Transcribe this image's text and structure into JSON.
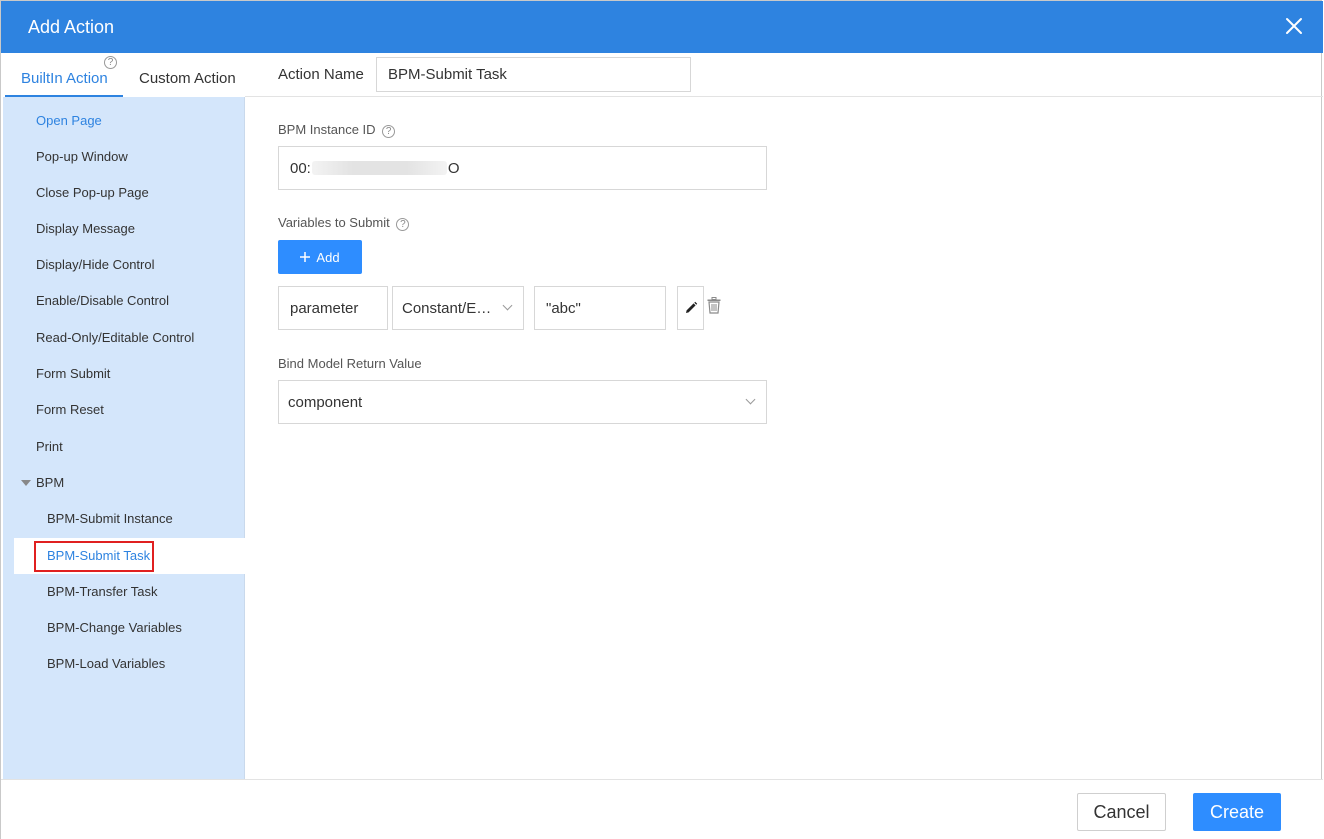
{
  "dialog": {
    "title": "Add Action",
    "close_icon": "close-icon"
  },
  "tabs": [
    {
      "label": "BuiltIn Action",
      "active": true
    },
    {
      "label": "Custom Action",
      "active": false
    }
  ],
  "tab_help": "?",
  "nav": {
    "items": [
      {
        "label": "Open Page"
      },
      {
        "label": "Pop-up Window"
      },
      {
        "label": "Close Pop-up Page"
      },
      {
        "label": "Display Message"
      },
      {
        "label": "Display/Hide Control"
      },
      {
        "label": "Enable/Disable Control"
      },
      {
        "label": "Read-Only/Editable Control"
      },
      {
        "label": "Form Submit"
      },
      {
        "label": "Form Reset"
      },
      {
        "label": "Print"
      }
    ],
    "group": {
      "label": "BPM",
      "expanded": true,
      "items": [
        {
          "label": "BPM-Submit Instance"
        },
        {
          "label": "BPM-Submit Task",
          "selected": true
        },
        {
          "label": "BPM-Transfer Task"
        },
        {
          "label": "BPM-Change Variables"
        },
        {
          "label": "BPM-Load Variables"
        }
      ]
    }
  },
  "form": {
    "action_name_label": "Action Name",
    "action_name_value": "BPM-Submit Task",
    "instance_id_label": "BPM Instance ID",
    "instance_id_prefix": "00:",
    "instance_id_suffix": "O",
    "variables_label": "Variables to Submit",
    "add_label": "Add",
    "variable": {
      "name": "parameter",
      "type": "Constant/E…",
      "value": "\"abc\""
    },
    "return_label": "Bind Model Return Value",
    "return_value": "component",
    "help": "?"
  },
  "footer": {
    "cancel_label": "Cancel",
    "create_label": "Create"
  },
  "colors": {
    "accent": "#2e83e0",
    "button": "#2e8dff",
    "sidebar": "#d4e6fb",
    "highlight": "#e02020"
  }
}
